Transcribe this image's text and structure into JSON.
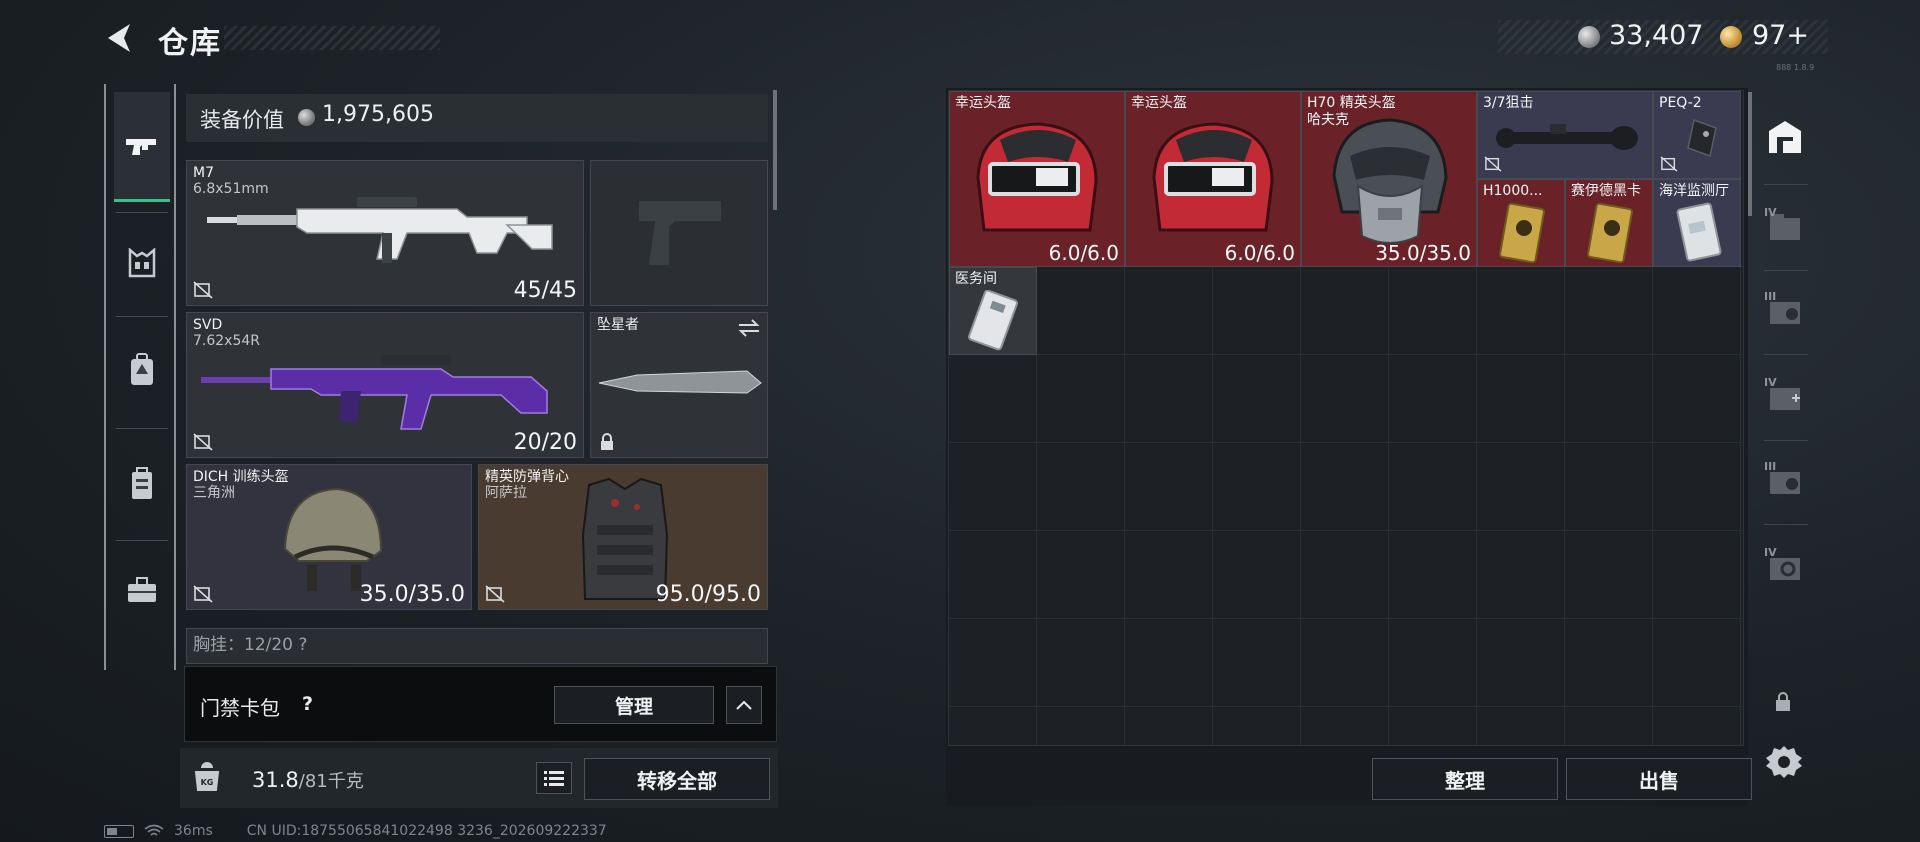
{
  "header": {
    "title": "仓库",
    "silver_amount": "33,407",
    "gold_amount": "97+",
    "tiny_text": "888 1.8.9"
  },
  "left_rail": {
    "items": [
      {
        "icon": "pistol-icon",
        "active": true
      },
      {
        "icon": "chest-rig-icon",
        "active": false
      },
      {
        "icon": "backpack-icon",
        "active": false
      },
      {
        "icon": "case-icon",
        "active": false
      },
      {
        "icon": "toolbox-icon",
        "active": false
      }
    ]
  },
  "equipment": {
    "value_label": "装备价值",
    "value_amount": "1,975,605",
    "slots": [
      {
        "name": "M7",
        "sub": "6.8x51mm",
        "count": "45/45",
        "tradable": false
      },
      {
        "name": "",
        "sub": "",
        "count": "",
        "placeholder": "pistol"
      },
      {
        "name": "SVD",
        "sub": "7.62x54R",
        "count": "20/20",
        "tradable": false
      },
      {
        "name": "坠星者",
        "sub": "",
        "count": "",
        "locked": true
      },
      {
        "name": "DICH 训练头盔",
        "sub": "三角洲",
        "count": "35.0/35.0",
        "tradable": false
      },
      {
        "name": "精英防弹背心",
        "sub": "阿萨拉",
        "count": "95.0/95.0",
        "tradable": false
      }
    ],
    "partial_row_text": "胸挂：12/20  ?"
  },
  "card_bar": {
    "label": "门禁卡包",
    "help": "?",
    "manage_label": "管理"
  },
  "weight": {
    "current": "31.8",
    "max": "/81千克",
    "transfer_all_label": "转移全部"
  },
  "status_bar": {
    "ping": "36ms",
    "uid": "CN UID:18755065841022498 3236_202609222337"
  },
  "storage": {
    "items": [
      {
        "name": "幸运头盔",
        "count": "6.0/6.0",
        "rarity": "red"
      },
      {
        "name": "幸运头盔",
        "count": "6.0/6.0",
        "rarity": "red"
      },
      {
        "name": "H70 精英头盔",
        "sub": "哈夫克",
        "count": "35.0/35.0",
        "rarity": "red"
      },
      {
        "name": "3/7狙击",
        "rarity": "purple"
      },
      {
        "name": "PEQ-2",
        "rarity": "purple"
      },
      {
        "name": "H1000...",
        "rarity": "red"
      },
      {
        "name": "赛伊德黑卡",
        "rarity": "red"
      },
      {
        "name": "海洋监测厅",
        "rarity": "purple"
      },
      {
        "name": "医务间",
        "rarity": "gray"
      }
    ],
    "tidy_label": "整理",
    "sell_label": "出售"
  },
  "right_rail": {
    "items": [
      {
        "icon": "warehouse-icon",
        "label": ""
      },
      {
        "icon": "storage-box-iv-icon",
        "label": "IV"
      },
      {
        "icon": "storage-box-iii-icon",
        "label": "III"
      },
      {
        "icon": "storage-box-iv-plus-icon",
        "label": "IV"
      },
      {
        "icon": "storage-box-iii-b-icon",
        "label": "III"
      },
      {
        "icon": "storage-box-iv-b-icon",
        "label": "IV"
      }
    ]
  },
  "colors": {
    "rarity_red": "#6a2228",
    "rarity_purple": "#3a3a50",
    "active_accent": "#39c08a",
    "panel_bg": "#2f3338"
  }
}
